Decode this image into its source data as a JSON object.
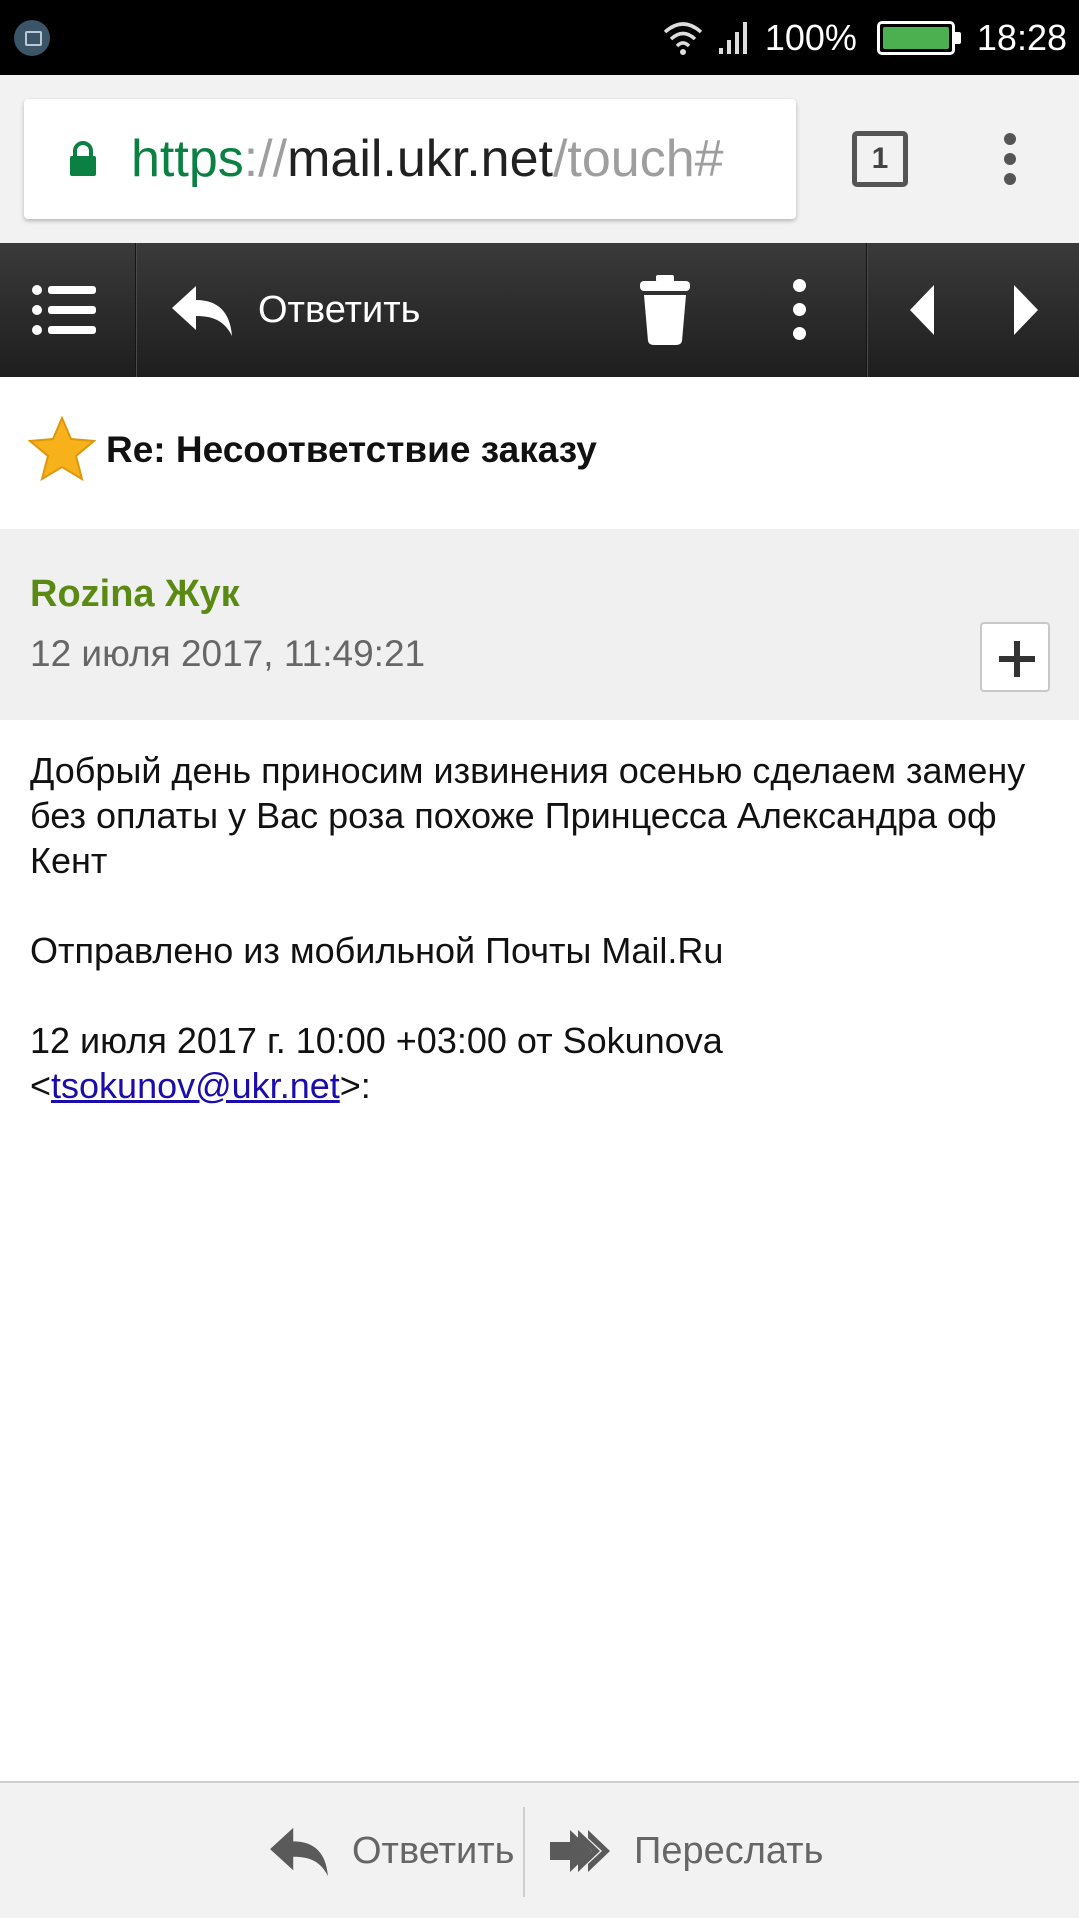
{
  "status_bar": {
    "battery_percent": "100%",
    "time": "18:28",
    "battery_color": "#4caf50"
  },
  "browser": {
    "url_scheme": "https",
    "url_sep": "://",
    "url_host": "mail.ukr.net",
    "url_path": "/touch#",
    "tab_count": "1"
  },
  "toolbar": {
    "reply_label": "Ответить"
  },
  "message": {
    "subject": "Re: Несоответствие заказу",
    "sender_name": "Rozina Жук",
    "date": "12 июля 2017, 11:49:21",
    "body_paragraph_1": "Добрый день приносим извинения осенью сделаем замену без оплаты у Вас роза похоже Принцесса Александра оф Кент",
    "body_paragraph_2": "Отправлено из мобильной Почты Mail.Ru",
    "quote_prefix": "12 июля 2017 г. 10:00 +03:00 от Sokunova",
    "quote_lt": "<",
    "quote_email": "tsokunov@ukr.net",
    "quote_gt": ">:"
  },
  "bottom_bar": {
    "reply_label": "Ответить",
    "forward_label": "Переслать"
  },
  "colors": {
    "sender_name": "#5a8a14",
    "link": "#1a0dab",
    "secure_scheme": "#0b8043"
  }
}
